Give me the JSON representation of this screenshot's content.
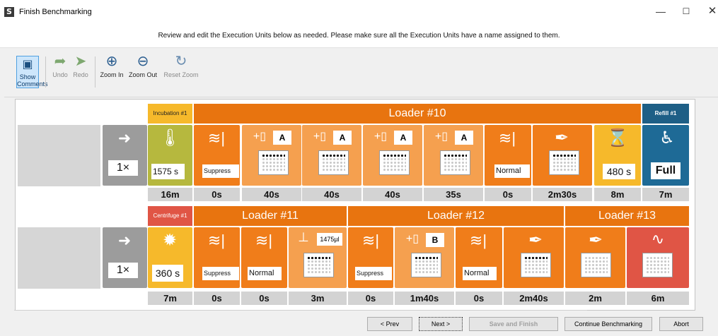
{
  "window": {
    "title": "Finish Benchmarking",
    "instructions": "Review and edit the Execution Units below as needed. Please make sure all the Execution Units have a name assigned to them."
  },
  "toolbar": {
    "show_comments": [
      "Show",
      "Comments"
    ],
    "undo": "Undo",
    "redo": "Redo",
    "zoom_in": "Zoom In",
    "zoom_out": "Zoom Out",
    "reset_zoom": "Reset Zoom"
  },
  "rows": [
    {
      "repeat": "1×",
      "headers": [
        "Incubation #1",
        "Loader #10",
        "Refill #1"
      ],
      "fields": {
        "incubation": "1575 s",
        "suppress": "Suppress",
        "normal": "Normal",
        "wait": "480 s",
        "refill": "Full"
      },
      "slots": [
        "A",
        "A",
        "A",
        "A"
      ],
      "times": [
        "16m",
        "0s",
        "40s",
        "40s",
        "40s",
        "35s",
        "0s",
        "2m30s",
        "8m",
        "7m"
      ]
    },
    {
      "repeat": "1×",
      "headers": [
        "Centrifuge #1",
        "Loader #11",
        "Loader #12",
        "Loader #13"
      ],
      "fields": {
        "centrifuge": "360 s",
        "suppress1": "Suppress",
        "normal1": "Normal",
        "volume": "1475µl",
        "suppress2": "Suppress",
        "normal2": "Normal"
      },
      "slots": [
        "B"
      ],
      "times": [
        "7m",
        "0s",
        "0s",
        "3m",
        "0s",
        "1m40s",
        "0s",
        "2m40s",
        "2m",
        "6m"
      ]
    }
  ],
  "footer": {
    "prev": "< Prev",
    "next": "Next >",
    "save_finish": "Save and Finish",
    "continue": "Continue Benchmarking",
    "abort": "Abort"
  },
  "colors": {
    "orange": "#f07d1a",
    "orange_light": "#f5a04f",
    "olive": "#b6b83e",
    "yellow": "#f6b92b",
    "teal": "#1e6a96",
    "red": "#e05545",
    "gray": "#9c9c9c"
  },
  "icons": [
    "app-icon",
    "comment-icon",
    "undo-icon",
    "redo-icon",
    "zoom-in-icon",
    "zoom-out-icon",
    "reset-zoom-icon",
    "arrow-in-icon",
    "thermometer-icon",
    "shake-icon",
    "add-tube-icon",
    "pipette-icon",
    "hourglass-icon",
    "refill-nozzle-icon",
    "centrifuge-icon",
    "dispense-icon",
    "waveform-icon"
  ]
}
